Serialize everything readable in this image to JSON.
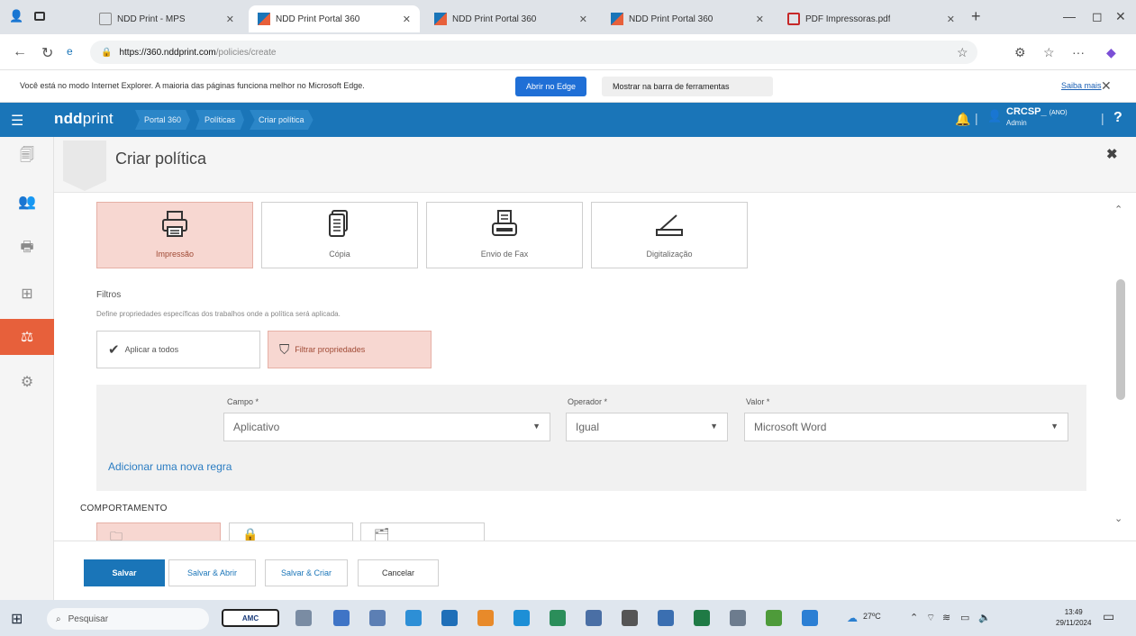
{
  "browser": {
    "tabs": [
      {
        "title": "NDD Print - MPS",
        "active": false
      },
      {
        "title": "NDD Print Portal 360",
        "active": true
      },
      {
        "title": "NDD Print Portal 360",
        "active": false
      },
      {
        "title": "NDD Print Portal 360",
        "active": false
      },
      {
        "title": "PDF Impressoras.pdf",
        "active": false
      }
    ],
    "url_host": "https://360.nddprint.com",
    "url_path": "/policies/create"
  },
  "ie_bar": {
    "message": "Você está no modo Internet Explorer. A maioria das páginas funciona melhor no Microsoft Edge.",
    "open_edge": "Abrir no Edge",
    "show_toolbar": "Mostrar na barra de ferramentas",
    "learn_more": "Saiba mais"
  },
  "header": {
    "logo_bold": "ndd",
    "logo_rest": "print",
    "breadcrumbs": [
      "Portal 360",
      "Políticas",
      "Criar política"
    ],
    "user_name": "CRCSP_",
    "user_tag": "(ANO)",
    "user_role": "Admin",
    "help": "?"
  },
  "page": {
    "title": "Criar política"
  },
  "job_types": [
    {
      "label": "Impressão",
      "selected": true
    },
    {
      "label": "Cópia",
      "selected": false
    },
    {
      "label": "Envio de Fax",
      "selected": false
    },
    {
      "label": "Digitalização",
      "selected": false
    }
  ],
  "filters": {
    "label": "Filtros",
    "description": "Define propriedades específicas dos trabalhos onde a política será aplicada.",
    "apply_all": "Aplicar a todos",
    "filter_props": "Filtrar propriedades"
  },
  "rule": {
    "field_label": "Campo *",
    "field_value": "Aplicativo",
    "operator_label": "Operador *",
    "operator_value": "Igual",
    "value_label": "Valor *",
    "value_value": "Microsoft Word",
    "add_rule": "Adicionar uma nova regra"
  },
  "behavior": {
    "title": "COMPORTAMENTO"
  },
  "footer": {
    "save": "Salvar",
    "save_open": "Salvar & Abrir",
    "save_create": "Salvar & Criar",
    "cancel": "Cancelar"
  },
  "taskbar": {
    "search": "Pesquisar",
    "amc": "AMC",
    "temperature": "27ºC",
    "time": "13:49",
    "date": "29/11/2024"
  },
  "colors": {
    "header_blue": "#1a75b8",
    "accent_orange": "#e7603b",
    "selected_pink": "#f7d7d1"
  }
}
